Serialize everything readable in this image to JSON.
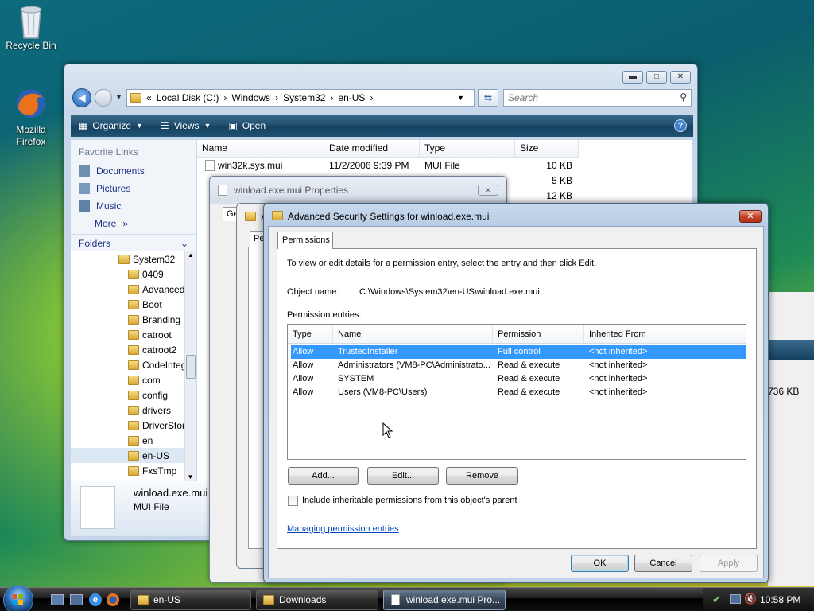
{
  "desktop": {
    "icons": [
      {
        "label": "Recycle Bin"
      },
      {
        "label": "Mozilla Firefox"
      }
    ]
  },
  "explorer": {
    "address": {
      "prefix": "«",
      "parts": [
        "Local Disk (C:)",
        "Windows",
        "System32",
        "en-US"
      ]
    },
    "search_placeholder": "Search",
    "toolbar": {
      "organize": "Organize",
      "views": "Views",
      "open": "Open"
    },
    "nav": {
      "favorites_header": "Favorite Links",
      "links": [
        "Documents",
        "Pictures",
        "Music"
      ],
      "more": "More",
      "folders_header": "Folders",
      "tree": [
        "System32",
        "0409",
        "Advanced",
        "Boot",
        "Branding",
        "catroot",
        "catroot2",
        "CodeIntegrity",
        "com",
        "config",
        "drivers",
        "DriverStore",
        "en",
        "en-US",
        "FxsTmp"
      ]
    },
    "columns": [
      "Name",
      "Date modified",
      "Type",
      "Size"
    ],
    "files": [
      {
        "name": "win32k.sys.mui",
        "date": "11/2/2006 9:39 PM",
        "type": "MUI File",
        "size": "10 KB"
      },
      {
        "name": "",
        "date": "",
        "type": "",
        "size": "5 KB"
      },
      {
        "name": "",
        "date": "",
        "type": "",
        "size": "12 KB"
      }
    ],
    "details": {
      "filename": "winload.exe.mui",
      "filetype": "MUI File"
    },
    "behind_size": "736 KB"
  },
  "properties": {
    "title": "winload.exe.mui Properties",
    "tab_fragment": "Ge",
    "second_tab_fragment": "Pe",
    "second_title_fragment": "A"
  },
  "advanced": {
    "title": "Advanced Security Settings for winload.exe.mui",
    "tab": "Permissions",
    "intro": "To view or edit details for a permission entry, select the entry and then click Edit.",
    "object_label": "Object name:",
    "object_value": "C:\\Windows\\System32\\en-US\\winload.exe.mui",
    "entries_label": "Permission entries:",
    "columns": [
      "Type",
      "Name",
      "Permission",
      "Inherited From"
    ],
    "rows": [
      {
        "type": "Allow",
        "name": "TrustedInstaller",
        "permission": "Full control",
        "inherited": "<not inherited>"
      },
      {
        "type": "Allow",
        "name": "Administrators (VM8-PC\\Administrato...",
        "permission": "Read & execute",
        "inherited": "<not inherited>"
      },
      {
        "type": "Allow",
        "name": "SYSTEM",
        "permission": "Read & execute",
        "inherited": "<not inherited>"
      },
      {
        "type": "Allow",
        "name": "Users (VM8-PC\\Users)",
        "permission": "Read & execute",
        "inherited": "<not inherited>"
      }
    ],
    "add_button": "Add...",
    "edit_button": "Edit...",
    "remove_button": "Remove",
    "checkbox_label": "Include inheritable permissions from this object's parent",
    "help_link": "Managing permission entries",
    "ok_button": "OK",
    "cancel_button": "Cancel",
    "apply_button": "Apply"
  },
  "taskbar": {
    "buttons": [
      "en-US",
      "Downloads",
      "winload.exe.mui Pro..."
    ],
    "clock": "10:58 PM"
  },
  "colors": {
    "selection": "#3399ff",
    "link": "#0044bb"
  }
}
